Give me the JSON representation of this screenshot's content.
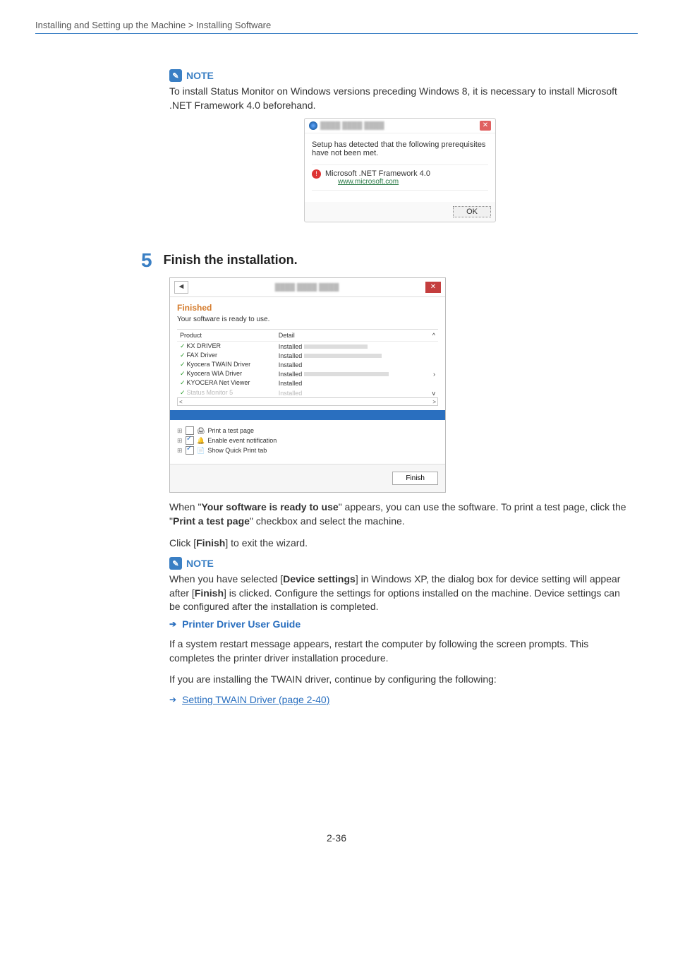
{
  "breadcrumb": "Installing and Setting up the Machine > Installing Software",
  "note1": {
    "label": "NOTE",
    "text": "To install Status Monitor on Windows versions preceding Windows 8, it is necessary to install Microsoft .NET Framework 4.0 beforehand."
  },
  "prereq_dialog": {
    "message": "Setup has detected that the following prerequisites have not been met.",
    "item": "Microsoft .NET Framework 4.0",
    "link": "www.microsoft.com",
    "ok": "OK"
  },
  "step": {
    "num": "5",
    "title": "Finish the installation."
  },
  "wizard": {
    "finished": "Finished",
    "ready": "Your software is ready to use.",
    "col_product": "Product",
    "col_detail": "Detail",
    "rows": [
      {
        "name": "KX DRIVER",
        "detail": "Installed"
      },
      {
        "name": "FAX Driver",
        "detail": "Installed"
      },
      {
        "name": "Kyocera TWAIN Driver",
        "detail": "Installed"
      },
      {
        "name": "Kyocera WIA Driver",
        "detail": "Installed"
      },
      {
        "name": "KYOCERA Net Viewer",
        "detail": "Installed"
      },
      {
        "name": "Status Monitor 5",
        "detail": "Installed"
      }
    ],
    "opts": [
      {
        "label": "Print a test page",
        "checked": false,
        "icon": "🖨"
      },
      {
        "label": "Enable event notification",
        "checked": true,
        "icon": "🔔"
      },
      {
        "label": "Show Quick Print tab",
        "checked": true,
        "icon": "📄"
      }
    ],
    "finish": "Finish"
  },
  "para1_a": "When \"",
  "para1_bold1": "Your software is ready to use",
  "para1_b": "\" appears, you can use the software. To print a test page, click the \"",
  "para1_bold2": "Print a test page",
  "para1_c": "\" checkbox and select the machine.",
  "para2_a": "Click [",
  "para2_bold": "Finish",
  "para2_b": "] to exit the wizard.",
  "note2": {
    "label": "NOTE",
    "a": "When you have selected [",
    "bold1": "Device settings",
    "b": "] in Windows XP, the dialog box for device setting will appear after [",
    "bold2": "Finish",
    "c": "] is clicked. Configure the settings for options installed on the machine. Device settings can be configured after the installation is completed.",
    "guide": "Printer Driver User Guide"
  },
  "para3": "If a system restart message appears, restart the computer by following the screen prompts. This completes the printer driver installation procedure.",
  "para4": "If you are installing the TWAIN driver, continue by configuring the following:",
  "twain_link": "Setting TWAIN Driver (page 2-40)",
  "page_num": "2-36"
}
